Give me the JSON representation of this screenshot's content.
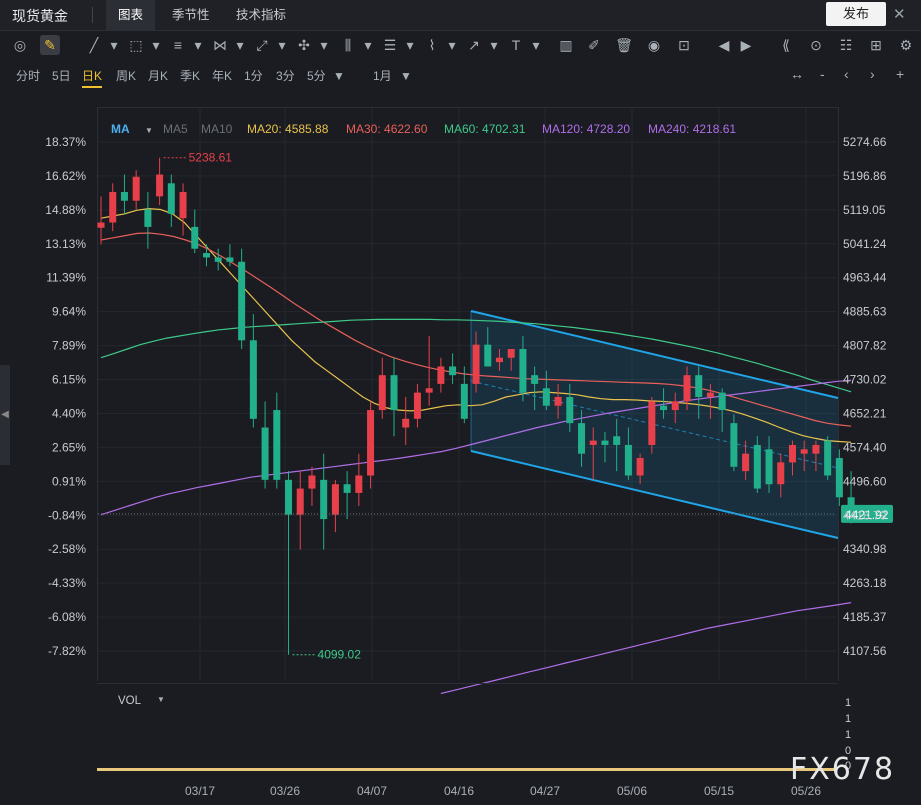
{
  "topbar": {
    "title": "现货黄金",
    "tabs": [
      "图表",
      "季节性",
      "技术指标"
    ],
    "publish": "发布"
  },
  "periods": {
    "items": [
      "分时",
      "5日",
      "日K",
      "周K",
      "月K",
      "季K",
      "年K",
      "1分",
      "3分",
      "5分"
    ],
    "active": "日K",
    "dropdown": "1月"
  },
  "colors": {
    "up": "#e8404a",
    "down": "#22b08c",
    "ma20": "#e8c24c",
    "ma30": "#e8605a",
    "ma60": "#3ec98a",
    "ma120": "#b06ee8",
    "channel": "#1fa6e8",
    "price_tag": "#22b08c"
  },
  "legend": {
    "ma": "MA",
    "ma5": "MA5",
    "ma10": "MA10",
    "ma20": "MA20: 4585.88",
    "ma30": "MA30: 4622.60",
    "ma60": "MA60: 4702.31",
    "ma120": "MA120: 4728.20",
    "ma240": "MA240: 4218.61"
  },
  "volume": {
    "label": "VOL",
    "ticks": [
      "1",
      "1",
      "1",
      "0",
      "0"
    ]
  },
  "watermark": "FX678",
  "chart_data": {
    "type": "candlestick",
    "title": "现货黄金",
    "ylim": [
      4080,
      5300
    ],
    "y_ticks_right": [
      5274.66,
      5196.86,
      5119.05,
      5041.24,
      4963.44,
      4885.63,
      4807.82,
      4730.02,
      4652.21,
      4574.4,
      4496.6,
      4418.79,
      4340.98,
      4263.18,
      4185.37,
      4107.56
    ],
    "y_ticks_left": [
      "18.37%",
      "16.62%",
      "14.88%",
      "13.13%",
      "11.39%",
      "9.64%",
      "7.89%",
      "6.15%",
      "4.40%",
      "2.65%",
      "0.91%",
      "-0.84%",
      "-2.58%",
      "-4.33%",
      "-6.08%",
      "-7.82%"
    ],
    "x_labels": [
      "03/17",
      "03/26",
      "04/07",
      "04/16",
      "04/27",
      "05/06",
      "05/15",
      "05/26"
    ],
    "current_price": "4421.92",
    "high_mark": "5238.61",
    "low_mark": "4099.02",
    "candles": [
      [
        5078,
        5150,
        5040,
        5090
      ],
      [
        5090,
        5180,
        5070,
        5160
      ],
      [
        5160,
        5200,
        5110,
        5140
      ],
      [
        5140,
        5210,
        5120,
        5195
      ],
      [
        5120,
        5160,
        5030,
        5080
      ],
      [
        5150,
        5238.61,
        5130,
        5200
      ],
      [
        5180,
        5200,
        5080,
        5110
      ],
      [
        5100,
        5180,
        5060,
        5160
      ],
      [
        5080,
        5120,
        5020,
        5030
      ],
      [
        5020,
        5040,
        4990,
        5010
      ],
      [
        5010,
        5030,
        4980,
        5000
      ],
      [
        5010,
        5040,
        4990,
        5000
      ],
      [
        5000,
        5030,
        4800,
        4820
      ],
      [
        4820,
        4880,
        4620,
        4640
      ],
      [
        4620,
        4680,
        4480,
        4500
      ],
      [
        4660,
        4700,
        4480,
        4500
      ],
      [
        4500,
        4520,
        4099.02,
        4420
      ],
      [
        4420,
        4520,
        4340,
        4480
      ],
      [
        4480,
        4530,
        4440,
        4510
      ],
      [
        4500,
        4560,
        4340,
        4410
      ],
      [
        4420,
        4500,
        4380,
        4490
      ],
      [
        4490,
        4520,
        4410,
        4470
      ],
      [
        4470,
        4560,
        4440,
        4510
      ],
      [
        4510,
        4680,
        4480,
        4660
      ],
      [
        4660,
        4780,
        4640,
        4740
      ],
      [
        4740,
        4780,
        4600,
        4660
      ],
      [
        4620,
        4690,
        4580,
        4640
      ],
      [
        4640,
        4720,
        4620,
        4700
      ],
      [
        4700,
        4830,
        4670,
        4710
      ],
      [
        4720,
        4780,
        4700,
        4760
      ],
      [
        4760,
        4790,
        4720,
        4740
      ],
      [
        4720,
        4760,
        4630,
        4640
      ],
      [
        4720,
        4840,
        4700,
        4810
      ],
      [
        4810,
        4850,
        4780,
        4760
      ],
      [
        4770,
        4800,
        4750,
        4780
      ],
      [
        4780,
        4800,
        4750,
        4800
      ],
      [
        4800,
        4830,
        4680,
        4700
      ],
      [
        4740,
        4760,
        4660,
        4720
      ],
      [
        4710,
        4750,
        4660,
        4670
      ],
      [
        4670,
        4720,
        4640,
        4690
      ],
      [
        4690,
        4720,
        4610,
        4630
      ],
      [
        4630,
        4660,
        4530,
        4560
      ],
      [
        4580,
        4620,
        4500,
        4590
      ],
      [
        4590,
        4610,
        4540,
        4580
      ],
      [
        4600,
        4640,
        4520,
        4580
      ],
      [
        4580,
        4620,
        4500,
        4510
      ],
      [
        4510,
        4560,
        4490,
        4550
      ],
      [
        4580,
        4690,
        4560,
        4680
      ],
      [
        4670,
        4710,
        4640,
        4660
      ],
      [
        4660,
        4700,
        4630,
        4680
      ],
      [
        4680,
        4760,
        4660,
        4740
      ],
      [
        4740,
        4760,
        4640,
        4690
      ],
      [
        4690,
        4720,
        4640,
        4700
      ],
      [
        4700,
        4710,
        4610,
        4660
      ],
      [
        4630,
        4650,
        4520,
        4530
      ],
      [
        4520,
        4590,
        4500,
        4560
      ],
      [
        4580,
        4600,
        4470,
        4480
      ],
      [
        4570,
        4600,
        4470,
        4490
      ],
      [
        4490,
        4560,
        4460,
        4540
      ],
      [
        4540,
        4590,
        4510,
        4580
      ],
      [
        4560,
        4590,
        4520,
        4570
      ],
      [
        4560,
        4590,
        4520,
        4580
      ],
      [
        4590,
        4600,
        4500,
        4510
      ],
      [
        4550,
        4570,
        4440,
        4460
      ],
      [
        4460,
        4520,
        4400,
        4421.92
      ]
    ],
    "ma": {
      "ma20": [
        5100,
        5105,
        5110,
        5118,
        5122,
        5120,
        5110,
        5090,
        5060,
        5030,
        5000,
        4970,
        4940,
        4910,
        4880,
        4850,
        4820,
        4795,
        4770,
        4750,
        4730,
        4710,
        4690,
        4675,
        4665,
        4660,
        4658,
        4660,
        4665,
        4670,
        4672,
        4670,
        4672,
        4680,
        4690,
        4695,
        4700,
        4702,
        4700,
        4698,
        4695,
        4690,
        4686,
        4684,
        4684,
        4683,
        4681,
        4680,
        4678,
        4676,
        4673,
        4669,
        4664,
        4658,
        4650,
        4641,
        4631,
        4620,
        4610,
        4601,
        4595,
        4590,
        4588,
        4586
      ],
      "ma30": [
        5050,
        5055,
        5060,
        5065,
        5066,
        5063,
        5058,
        5050,
        5040,
        5027,
        5012,
        4995,
        4978,
        4960,
        4942,
        4923,
        4904,
        4886,
        4868,
        4852,
        4836,
        4820,
        4806,
        4793,
        4782,
        4773,
        4765,
        4758,
        4752,
        4747,
        4743,
        4740,
        4738,
        4736,
        4734,
        4732,
        4731,
        4730,
        4729,
        4728,
        4727,
        4726,
        4725,
        4724,
        4723,
        4722,
        4721,
        4719,
        4716,
        4712,
        4707,
        4700,
        4692,
        4684,
        4676,
        4668,
        4660,
        4652,
        4644,
        4636,
        4630,
        4626,
        4623
      ],
      "ma60": [
        4780,
        4790,
        4800,
        4810,
        4818,
        4825,
        4830,
        4835,
        4840,
        4844,
        4847,
        4850,
        4852,
        4854,
        4856,
        4858,
        4860,
        4862,
        4864,
        4866,
        4867,
        4868,
        4868,
        4868,
        4868,
        4868,
        4867,
        4867,
        4866,
        4865,
        4864,
        4862,
        4860,
        4858,
        4855,
        4852,
        4849,
        4845,
        4841,
        4837,
        4832,
        4827,
        4822,
        4816,
        4810,
        4804,
        4797,
        4790,
        4782,
        4774,
        4766,
        4757,
        4748,
        4739,
        4729,
        4720,
        4711,
        4702
      ],
      "ma120": [
        4420,
        4430,
        4440,
        4450,
        4460,
        4468,
        4475,
        4482,
        4488,
        4494,
        4500,
        4506,
        4510,
        4514,
        4518,
        4522,
        4526,
        4530,
        4534,
        4538,
        4542,
        4546,
        4550,
        4555,
        4560,
        4565,
        4572,
        4580,
        4588,
        4596,
        4604,
        4612,
        4620,
        4627,
        4634,
        4640,
        4646,
        4652,
        4657,
        4662,
        4667,
        4672,
        4677,
        4682,
        4686,
        4690,
        4694,
        4698,
        4702,
        4706,
        4710,
        4714,
        4718,
        4722,
        4726,
        4728
      ],
      "ma240": [
        4010,
        4020,
        4030,
        4040,
        4050,
        4060,
        4070,
        4080,
        4090,
        4100,
        4110,
        4120,
        4130,
        4140,
        4150,
        4160,
        4168,
        4176,
        4184,
        4192,
        4200,
        4206,
        4212,
        4218.61
      ]
    }
  }
}
